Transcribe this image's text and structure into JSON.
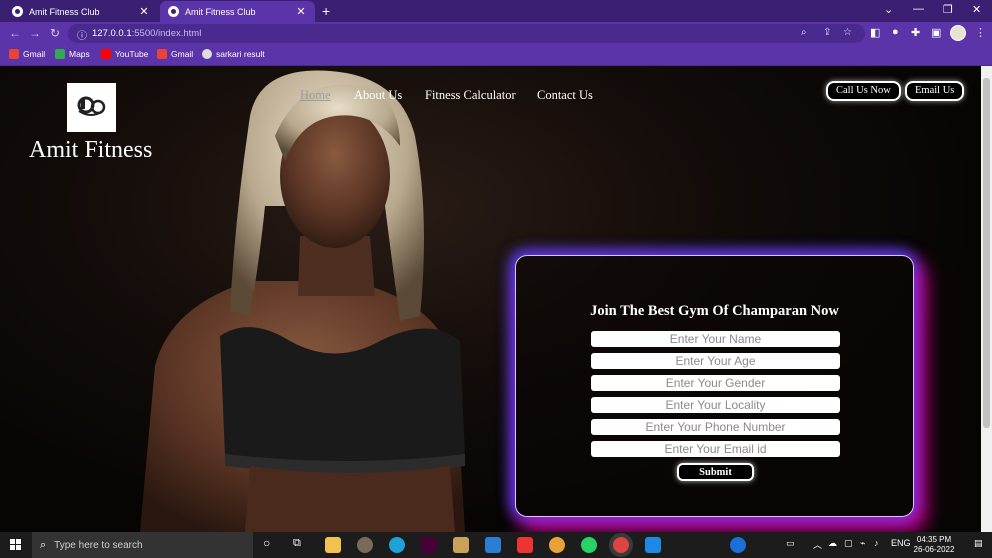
{
  "browser": {
    "tabs": [
      {
        "title": "Amit Fitness Club",
        "active": false
      },
      {
        "title": "Amit Fitness Club",
        "active": true
      }
    ],
    "url_host": "127.0.0.1",
    "url_rest": ":5500/index.html",
    "bookmarks": [
      "Gmail",
      "Maps",
      "YouTube",
      "Gmail",
      "sarkari result"
    ]
  },
  "site": {
    "brand": "Amit Fitness",
    "nav": [
      "Home",
      "About Us",
      "Fitness Calculator",
      "Contact Us"
    ],
    "call_button": "Call Us Now",
    "email_button": "Email Us",
    "form": {
      "title": "Join The Best Gym Of Champaran Now",
      "placeholders": [
        "Enter Your Name",
        "Enter Your Age",
        "Enter Your Gender",
        "Enter Your Locality",
        "Enter Your Phone Number",
        "Enter Your Email id"
      ],
      "submit": "Submit"
    }
  },
  "taskbar": {
    "search_placeholder": "Type here to search",
    "language": "ENG",
    "time": "04:35 PM",
    "date": "26-06-2022"
  },
  "colors": {
    "tabbar": "#3b1f73",
    "toolbar": "#5a34a8",
    "glow_blue": "#5a3cff",
    "glow_pink": "#ff00aa"
  }
}
